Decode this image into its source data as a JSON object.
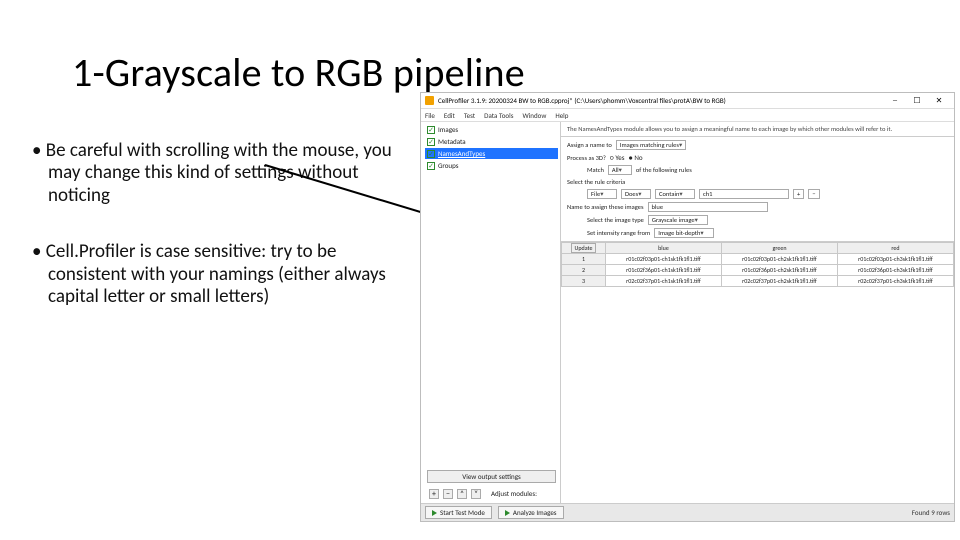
{
  "slide": {
    "title": "1-Grayscale to RGB pipeline",
    "bullet1": "Be careful with scrolling with the mouse, you may change this kind of settings without noticing",
    "bullet2": "Cell.Profiler is case sensitive: try to be consistent with your namings (either always capital letter or small letters)"
  },
  "app": {
    "title": "CellProfiler 3.1.9: 20200324 BW to RGB.cpproj* (C:\\Users\\phomm\\Voxcentral files\\protA\\BW to RGB)",
    "menu": {
      "file": "File",
      "edit": "Edit",
      "test": "Test",
      "data": "Data Tools",
      "window": "Window",
      "help": "Help"
    },
    "modules": {
      "images": "Images",
      "metadata": "Metadata",
      "names": "NamesAndTypes",
      "groups": "Groups"
    },
    "output_btn": "View output settings",
    "adjust": "Adjust modules:",
    "desc": "The NamesAndTypes module allows you to assign a meaningful name to each image by which other modules will refer to it.",
    "settings": {
      "assign_label": "Assign a name to",
      "assign_val": "Images matching rules",
      "process3d": "Process as 3D?",
      "yes": "Yes",
      "no": "No",
      "match_label": "Match",
      "match_val": "All",
      "match_suffix": "of the following rules",
      "select_rule": "Select the rule criteria",
      "r_subject": "File",
      "r_verb": "Does",
      "r_cond": "Contain",
      "r_value": "ch1",
      "name_label": "Name to assign these images",
      "name_value": "blue",
      "imgtype_label": "Select the image type",
      "imgtype_value": "Grayscale image",
      "intensity_label": "Set intensity range from",
      "intensity_value": "Image bit-depth"
    },
    "table": {
      "cols": [
        "",
        "blue",
        "green",
        "red"
      ],
      "update": "Update",
      "rows": [
        [
          "1",
          "r01c02f03p01-ch1sk1fk1fl1.tiff",
          "r01c02f03p01-ch2sk1fk1fl1.tiff",
          "r01c02f03p01-ch3sk1fk1fl1.tiff"
        ],
        [
          "2",
          "r01c02f36p01-ch1sk1fk1fl1.tiff",
          "r01c02f36p01-ch2sk1fk1fl1.tiff",
          "r01c02f36p01-ch3sk1fk1fl1.tiff"
        ],
        [
          "3",
          "r02c02f37p01-ch1sk1fk1fl1.tiff",
          "r02c02f37p01-ch2sk1fk1fl1.tiff",
          "r02c02f37p01-ch3sk1fk1fl1.tiff"
        ]
      ]
    },
    "status": {
      "test": "Start Test Mode",
      "analyze": "Analyze Images",
      "found": "Found 9 rows"
    }
  }
}
